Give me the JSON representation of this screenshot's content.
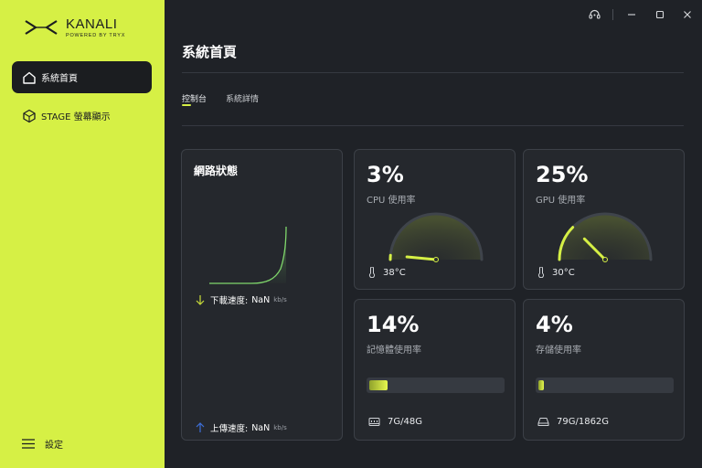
{
  "app": {
    "name": "KANALI",
    "tagline": "POWERED BY TRYX"
  },
  "sidebar": {
    "items": [
      {
        "label": "系統首頁",
        "icon": "home-icon",
        "active": true
      },
      {
        "label": "STAGE 螢幕顯示",
        "icon": "hexagon-icon",
        "active": false
      }
    ],
    "settings_label": "設定"
  },
  "page": {
    "title": "系統首頁",
    "tabs": [
      {
        "label": "控制台",
        "active": true
      },
      {
        "label": "系統詳情",
        "active": false
      }
    ]
  },
  "network": {
    "title": "網路狀態",
    "download_label": "下載速度:",
    "download_value": "NaN",
    "download_unit": "kb/s",
    "upload_label": "上傳速度:",
    "upload_value": "NaN",
    "upload_unit": "kb/s"
  },
  "cpu": {
    "percent_text": "3%",
    "percent": 3,
    "label": "CPU 使用率",
    "temp": "38°C"
  },
  "gpu": {
    "percent_text": "25%",
    "percent": 25,
    "label": "GPU 使用率",
    "temp": "30°C"
  },
  "memory": {
    "percent_text": "14%",
    "percent": 14,
    "label": "記憶體使用率",
    "capacity": "7G/48G"
  },
  "storage": {
    "percent_text": "4%",
    "percent": 4,
    "label": "存儲使用率",
    "capacity": "79G/1862G"
  },
  "colors": {
    "accent": "#d6f045",
    "background": "#1f2227",
    "card": "#25282d",
    "download_arrow": "#c9dc3a",
    "upload_arrow": "#3d6fd8",
    "chart_line": "#7fd66b"
  }
}
